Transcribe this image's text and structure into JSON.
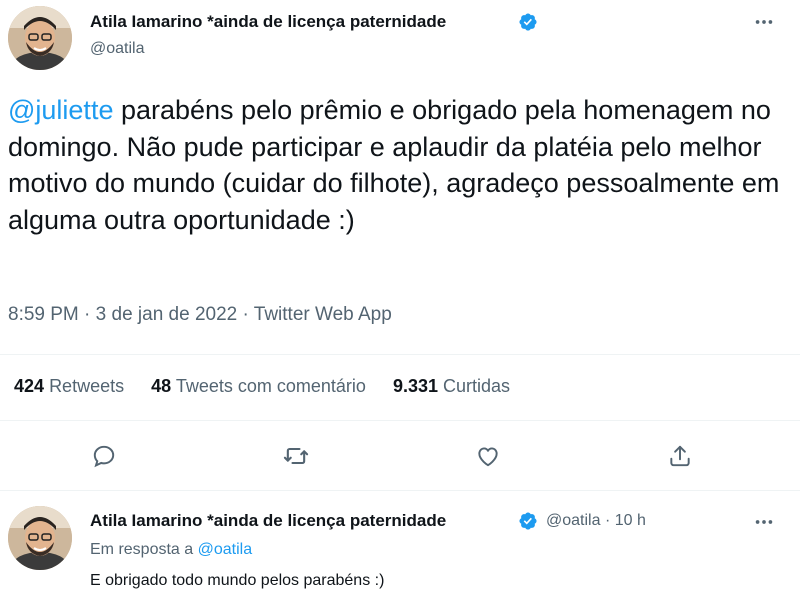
{
  "main_tweet": {
    "author_name": "Atila Iamarino *ainda de licença paternidade",
    "handle": "@oatila",
    "mention": "@juliette",
    "text": " parabéns pelo prêmio e obrigado pela homenagem no domingo. Não pude participar e aplaudir da platéia pelo melhor motivo do mundo (cuidar do filhote), agradeço pessoalmente em alguma outra oportunidade :)",
    "time": "8:59 PM",
    "date": "3 de jan de 2022",
    "source": "Twitter Web App",
    "sep": "·"
  },
  "stats": {
    "retweets_count": "424",
    "retweets_label": "Retweets",
    "quotes_count": "48",
    "quotes_label": "Tweets com comentário",
    "likes_count": "9.331",
    "likes_label": "Curtidas"
  },
  "reply_tweet": {
    "author_name": "Atila Iamarino *ainda de licença paternidade",
    "handle": "@oatila",
    "sep": "·",
    "age": "10 h",
    "in_reply_prefix": "Em resposta a ",
    "in_reply_handle": "@oatila",
    "text": "E obrigado todo mundo pelos parabéns :)"
  },
  "icons": {
    "verified": "verified-badge-icon",
    "more": "more-icon",
    "reply": "reply-icon",
    "retweet": "retweet-icon",
    "like": "heart-icon",
    "share": "share-icon"
  },
  "colors": {
    "accent": "#1d9bf0",
    "text": "#0f1419",
    "muted": "#536471",
    "divider": "#eff3f4"
  }
}
